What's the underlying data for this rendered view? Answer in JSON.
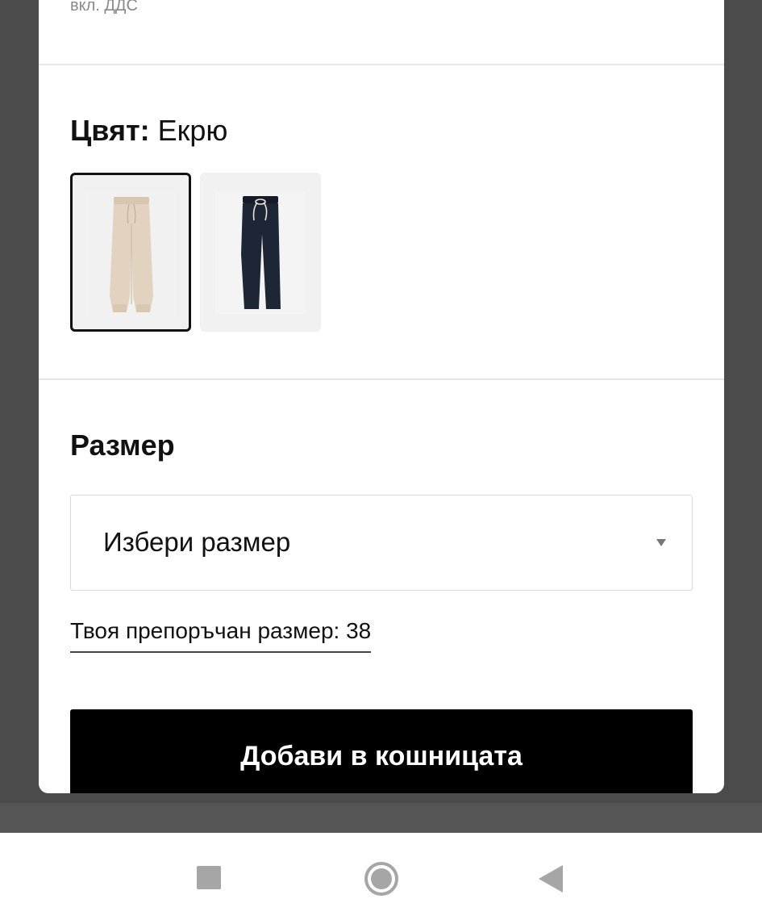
{
  "price": {
    "tax_note": "вкл. ДДС"
  },
  "color": {
    "label": "Цвят:",
    "selected_value": "Екрю",
    "swatches": [
      {
        "name": "Екрю",
        "color": "#e2d3c0",
        "selected": true
      },
      {
        "name": "navy",
        "color": "#1d2634",
        "selected": false
      }
    ]
  },
  "size": {
    "heading": "Размер",
    "select_placeholder": "Избери размер",
    "recommended_link": "Твоя препоръчан размер: 38"
  },
  "actions": {
    "add_to_cart": "Добави в кошницата"
  },
  "system_nav": {
    "icons": [
      "recents-icon",
      "home-icon",
      "back-icon"
    ]
  }
}
